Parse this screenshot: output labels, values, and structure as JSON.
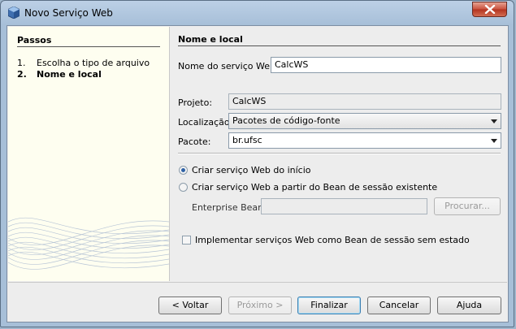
{
  "window": {
    "title": "Novo Serviço Web"
  },
  "steps": {
    "title": "Passos",
    "items": [
      {
        "num": "1.",
        "label": "Escolha o tipo de arquivo",
        "active": false
      },
      {
        "num": "2.",
        "label": "Nome e local",
        "active": true
      }
    ]
  },
  "panel": {
    "title": "Nome e local",
    "service_name": {
      "label": "Nome do serviço Web:",
      "value": "CalcWS"
    },
    "project": {
      "label": "Projeto:",
      "value": "CalcWS"
    },
    "location": {
      "label": "Localização:",
      "value": "Pacotes de código-fonte"
    },
    "package": {
      "label": "Pacote:",
      "value": "br.ufsc"
    },
    "radio_new": {
      "label": "Criar serviço Web do início",
      "selected": true
    },
    "radio_bean": {
      "label": "Criar serviço Web a partir do Bean de sessão existente",
      "selected": false
    },
    "enterprise_bean": {
      "label": "Enterprise Bean:",
      "value": "",
      "browse_label": "Procurar..."
    },
    "stateless": {
      "label": "Implementar serviços Web como Bean de sessão sem estado",
      "checked": false
    }
  },
  "buttons": {
    "back": "< Voltar",
    "next": "Próximo >",
    "finish": "Finalizar",
    "cancel": "Cancelar",
    "help": "Ajuda"
  }
}
